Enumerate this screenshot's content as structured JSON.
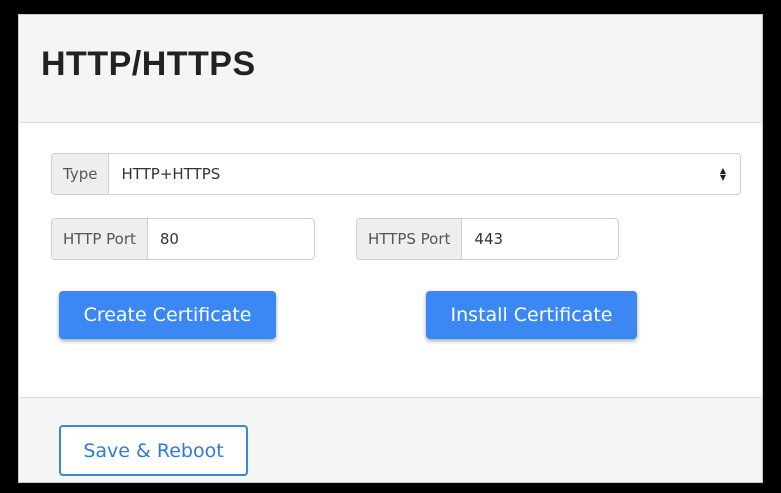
{
  "panel": {
    "title": "HTTP/HTTPS"
  },
  "type_select": {
    "label": "Type",
    "value": "HTTP+HTTPS",
    "caret_up": "▲",
    "caret_down": "▼"
  },
  "http_port": {
    "label": "HTTP Port",
    "value": "80"
  },
  "https_port": {
    "label": "HTTPS Port",
    "value": "443"
  },
  "buttons": {
    "create_certificate": "Create Certificate",
    "install_certificate": "Install Certificate",
    "save_reboot": "Save & Reboot"
  },
  "colors": {
    "primary": "#3b88f5",
    "outline": "#3a86d8",
    "header_bg": "#f5f5f5"
  }
}
